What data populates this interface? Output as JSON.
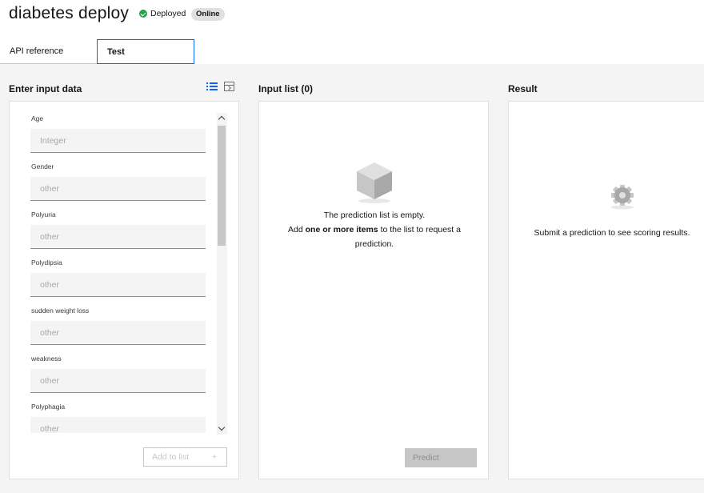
{
  "header": {
    "title": "diabetes deploy",
    "status_text": "Deployed",
    "badge": "Online"
  },
  "tabs": [
    {
      "label": "API reference",
      "active": false
    },
    {
      "label": "Test",
      "active": true
    }
  ],
  "input_panel": {
    "title": "Enter input data",
    "fields": [
      {
        "label": "Age",
        "placeholder": "Integer"
      },
      {
        "label": "Gender",
        "placeholder": "other"
      },
      {
        "label": "Polyuria",
        "placeholder": "other"
      },
      {
        "label": "Polydipsia",
        "placeholder": "other"
      },
      {
        "label": "sudden weight loss",
        "placeholder": "other"
      },
      {
        "label": "weakness",
        "placeholder": "other"
      },
      {
        "label": "Polyphagia",
        "placeholder": "other"
      }
    ],
    "add_button_label": "Add to list",
    "add_button_icon": "+"
  },
  "input_list": {
    "title": "Input list (0)",
    "empty_line1": "The prediction list is empty.",
    "empty_line2_pre": "Add ",
    "empty_line2_bold": "one or more items",
    "empty_line2_post": " to the list to request a",
    "empty_line3": "prediction.",
    "predict_label": "Predict"
  },
  "result": {
    "title": "Result",
    "empty_text": "Submit a prediction to see scoring results."
  },
  "colors": {
    "accent": "#0f62fe",
    "success": "#24a148",
    "background": "#f4f4f4"
  },
  "icons": {
    "status": "checkmark-filled-icon",
    "list_view": "list-icon",
    "form_view": "form-view-icon",
    "empty_list": "cube-icon",
    "empty_result": "gear-icon"
  }
}
